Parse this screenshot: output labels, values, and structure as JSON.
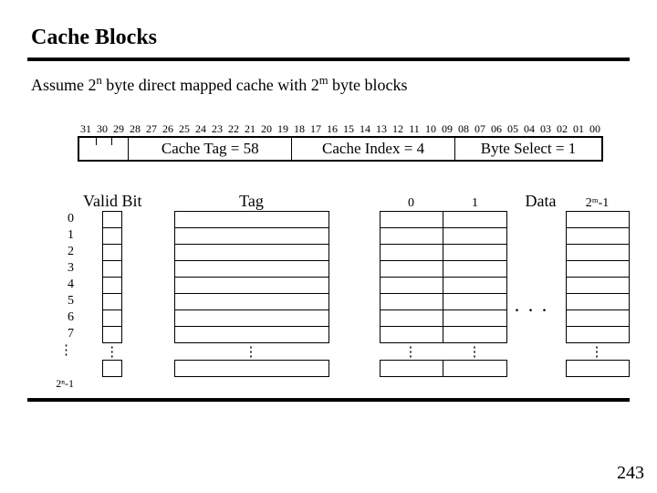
{
  "title": "Cache Blocks",
  "assume_pre": "Assume 2",
  "assume_n": "n",
  "assume_mid": " byte direct mapped cache with 2",
  "assume_m": "m",
  "assume_post": " byte blocks",
  "bits": [
    "31",
    "30",
    "29",
    "28",
    "27",
    "26",
    "25",
    "24",
    "23",
    "22",
    "21",
    "20",
    "19",
    "18",
    "17",
    "16",
    "15",
    "14",
    "13",
    "12",
    "11",
    "10",
    "09",
    "08",
    "07",
    "06",
    "05",
    "04",
    "03",
    "02",
    "01",
    "00"
  ],
  "fields": {
    "tag": "Cache Tag = 58",
    "index": "Cache Index = 4",
    "bsel": "Byte Select = 1"
  },
  "col_headers": {
    "valid": "Valid Bit",
    "tag": "Tag",
    "d0": "0",
    "d1": "1",
    "data": "Data",
    "dend": "2ᵐ-1"
  },
  "row_labels": [
    "0",
    "1",
    "2",
    "3",
    "4",
    "5",
    "6",
    "7"
  ],
  "vdots": "⋮",
  "hdots": ". . .",
  "last_row_label": "2ⁿ-1",
  "page_number": "243"
}
